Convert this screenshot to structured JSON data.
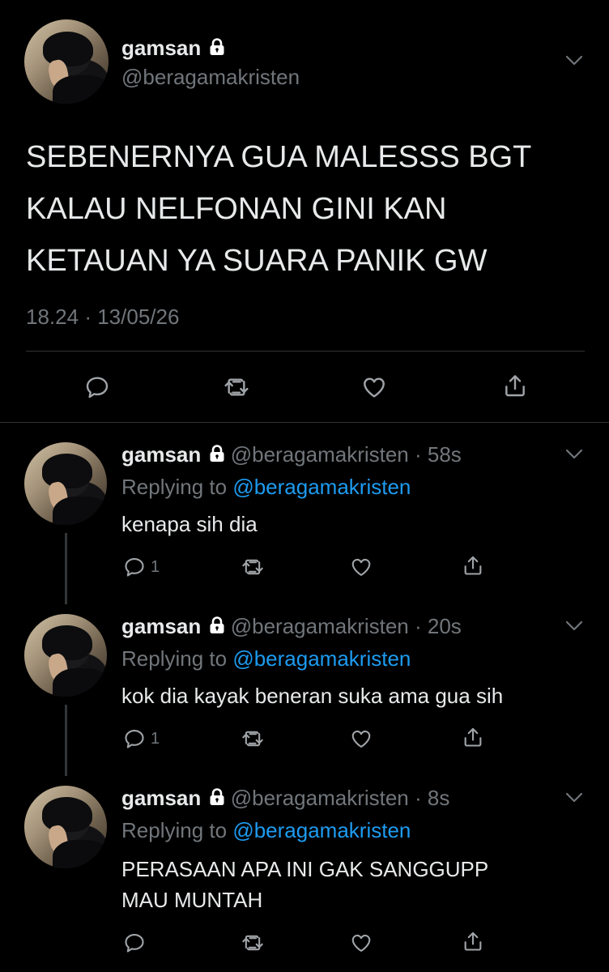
{
  "main_tweet": {
    "name": "gamsan",
    "handle": "@beragamakristen",
    "text_lines": [
      "SEBENERNYA GUA MALESSS BGT",
      "KALAU NELFONAN GINI KAN",
      "KETAUAN YA SUARA PANIK GW"
    ],
    "time": "18.24",
    "separator": "·",
    "date": "13/05/26"
  },
  "replies": [
    {
      "name": "gamsan",
      "handle_time": "@beragamakristen · 58s",
      "replying_label": "Replying to",
      "replying_mention": "@beragamakristen",
      "text_lines": [
        "kenapa sih dia"
      ],
      "reply_count": "1"
    },
    {
      "name": "gamsan",
      "handle_time": "@beragamakristen · 20s",
      "replying_label": "Replying to",
      "replying_mention": "@beragamakristen",
      "text_lines": [
        "kok dia kayak beneran suka ama gua sih"
      ],
      "reply_count": "1"
    },
    {
      "name": "gamsan",
      "handle_time": "@beragamakristen · 8s",
      "replying_label": "Replying to",
      "replying_mention": "@beragamakristen",
      "text_lines": [
        "PERASAAN APA INI GAK SANGGUPP",
        "MAU MUNTAH"
      ],
      "reply_count": ""
    }
  ],
  "icons": {
    "lock": "lock-icon",
    "chevron": "chevron-down-icon",
    "reply": "reply-icon",
    "retweet": "retweet-icon",
    "like": "heart-icon",
    "share": "share-icon"
  },
  "colors": {
    "background": "#000000",
    "text": "#e7e9ea",
    "secondary": "#71767b",
    "link": "#1d9bf0",
    "divider": "#2f3336"
  }
}
